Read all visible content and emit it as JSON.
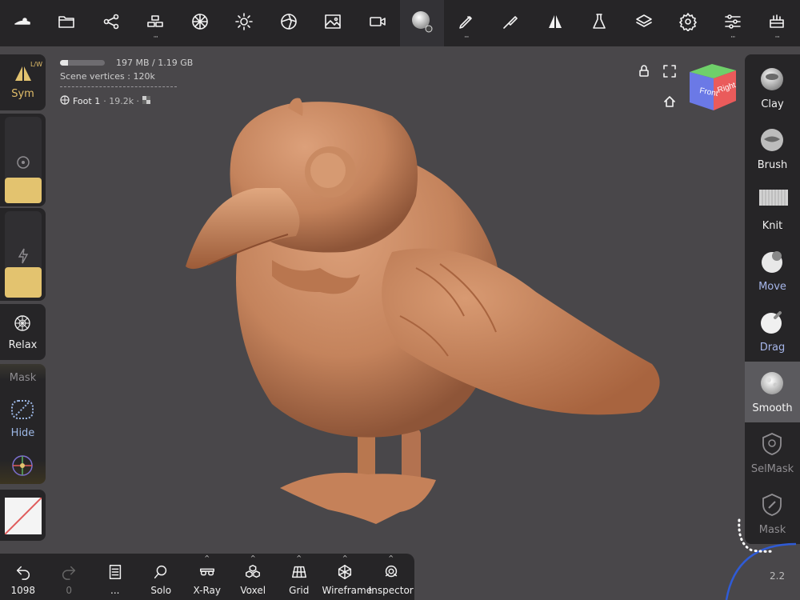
{
  "top_toolbar": {
    "items": [
      {
        "name": "menu-icon",
        "dots": false
      },
      {
        "name": "folder-icon",
        "dots": false
      },
      {
        "name": "scene-graph-icon",
        "dots": false
      },
      {
        "name": "primitives-icon",
        "dots": true
      },
      {
        "name": "topology-icon",
        "dots": false
      },
      {
        "name": "lighting-icon",
        "dots": false
      },
      {
        "name": "shading-icon",
        "dots": false
      },
      {
        "name": "background-image-icon",
        "dots": false
      },
      {
        "name": "camera-icon",
        "dots": false
      },
      {
        "name": "active-brush-icon",
        "dots": false
      },
      {
        "name": "stroke-icon",
        "dots": true
      },
      {
        "name": "paint-icon",
        "dots": false
      },
      {
        "name": "symmetry-icon",
        "dots": false
      },
      {
        "name": "material-icon",
        "dots": false
      },
      {
        "name": "layers-icon",
        "dots": false
      },
      {
        "name": "settings-icon",
        "dots": false
      },
      {
        "name": "tool-settings-icon",
        "dots": true
      },
      {
        "name": "toolbox-icon",
        "dots": true
      }
    ]
  },
  "scene_info": {
    "memory": "197 MB / 1.19 GB",
    "memory_fraction": 0.17,
    "vertices": "Scene vertices : 120k",
    "object_name": "Foot 1",
    "object_sub": "· 19.2k ·"
  },
  "left_panel": {
    "sym_label": "Sym",
    "lw_label": "L/W",
    "radius_fraction": 0.2,
    "intensity_fraction": 0.3,
    "relax_label": "Relax",
    "mask_label": "Mask",
    "hide_label": "Hide"
  },
  "right_panel": {
    "tools": [
      {
        "label": "Clay",
        "color": "#f0f0f0",
        "selected": false,
        "icon": "clay-sphere"
      },
      {
        "label": "Brush",
        "color": "#f0f0f0",
        "selected": false,
        "icon": "brush-sphere"
      },
      {
        "label": "Knit",
        "color": "#f0f0f0",
        "selected": false,
        "icon": "knit-plane"
      },
      {
        "label": "Move",
        "color": "#a6b6ea",
        "selected": false,
        "icon": "move-sphere"
      },
      {
        "label": "Drag",
        "color": "#a6b6ea",
        "selected": false,
        "icon": "drag-sphere"
      },
      {
        "label": "Smooth",
        "color": "#f5f5f5",
        "selected": true,
        "icon": "smooth-sphere"
      },
      {
        "label": "SelMask",
        "color": "#8f8d91",
        "selected": false,
        "icon": "selmask-shield"
      },
      {
        "label": "Mask",
        "color": "#8f8d91",
        "selected": false,
        "icon": "mask-shield"
      }
    ]
  },
  "bottom_bar": {
    "undo_count": "1098",
    "redo_count": "0",
    "items": [
      {
        "label": "...",
        "name": "history-icon"
      },
      {
        "label": "Solo",
        "name": "solo-icon"
      },
      {
        "label": "X-Ray",
        "name": "xray-icon"
      },
      {
        "label": "Voxel",
        "name": "voxel-icon"
      },
      {
        "label": "Grid",
        "name": "grid-icon"
      },
      {
        "label": "Wireframe",
        "name": "wireframe-icon"
      },
      {
        "label": "Inspector",
        "name": "inspector-icon"
      }
    ]
  },
  "nav_cube": {
    "front": "Front",
    "right": "Right"
  },
  "zoom_value": "2.2",
  "colors": {
    "accent_gold": "#e3c36f",
    "model_clay": "#c7865e",
    "toolbar_bg": "#262527",
    "viewport_bg": "#49474a"
  }
}
